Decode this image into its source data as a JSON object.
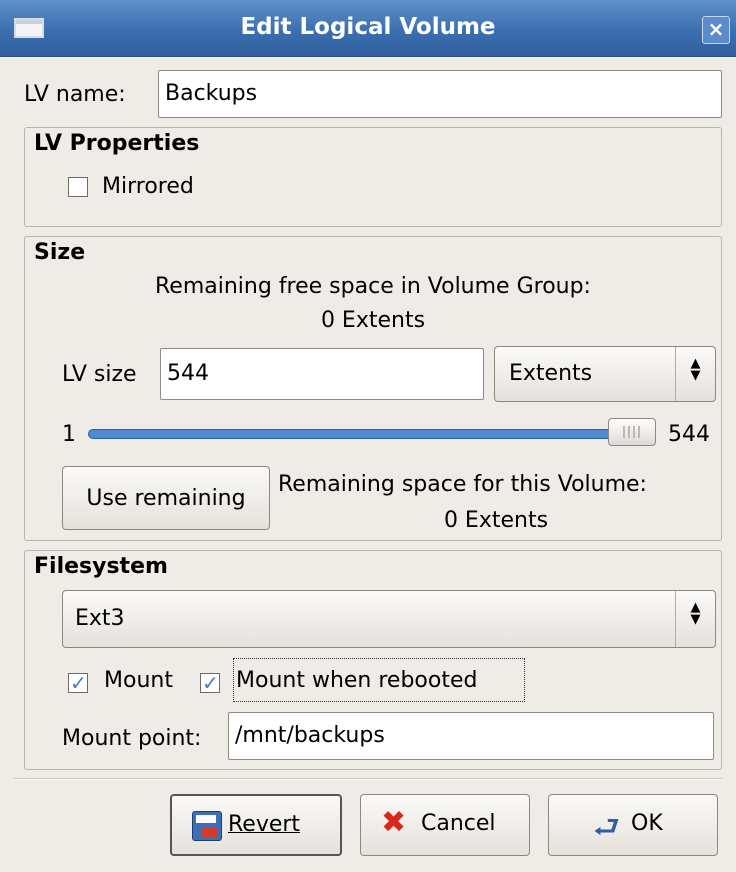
{
  "window": {
    "title": "Edit Logical Volume",
    "close_label": "×"
  },
  "lv_name": {
    "label": "LV name:",
    "value": "Backups"
  },
  "lv_properties": {
    "title": "LV Properties",
    "mirrored_label": "Mirrored",
    "mirrored_checked": false
  },
  "size": {
    "title": "Size",
    "free_space_line1": "Remaining free space in Volume Group:",
    "free_space_line2": "0 Extents",
    "lv_size_label": "LV size",
    "lv_size_value": "544",
    "unit_selected": "Extents",
    "slider_min": "1",
    "slider_max": "544",
    "slider_value": 544,
    "use_remaining_label": "Use remaining",
    "remaining_volume_line1": "Remaining space for this Volume:",
    "remaining_volume_line2": "0 Extents"
  },
  "filesystem": {
    "title": "Filesystem",
    "selected": "Ext3",
    "mount_label": "Mount",
    "mount_checked": true,
    "mount_rebooted_label": "Mount when rebooted",
    "mount_rebooted_checked": true,
    "mount_point_label": "Mount point:",
    "mount_point_value": "/mnt/backups"
  },
  "buttons": {
    "revert_label": "Revert",
    "cancel_label": "Cancel",
    "ok_label": "OK"
  },
  "colors": {
    "titlebar": "#3c6fb0",
    "accent": "#4d8bd2",
    "background": "#efebe7"
  }
}
